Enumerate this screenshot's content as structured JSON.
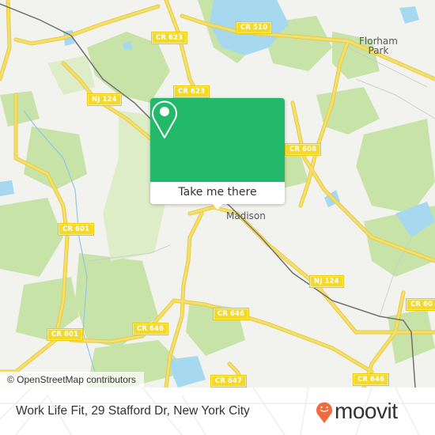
{
  "map": {
    "attribution": "© OpenStreetMap contributors",
    "colors": {
      "land": "#f2f2ee",
      "forest": "#c8e3a8",
      "park": "#dcedc8",
      "water": "#a6d8ef",
      "road": "#f5df6b",
      "road_casing": "#e8cb45",
      "rail": "#707070"
    },
    "places": [
      {
        "name": "Florham\nPark",
        "id": "florham-park"
      },
      {
        "name": "Madison",
        "id": "madison"
      }
    ],
    "road_shields": [
      {
        "label": "CR 623",
        "id": "cr623-top"
      },
      {
        "label": "CR 510",
        "id": "cr510"
      },
      {
        "label": "CR 623",
        "id": "cr623-mid"
      },
      {
        "label": "NJ 124",
        "id": "nj124-top"
      },
      {
        "label": "CR 608",
        "id": "cr608"
      },
      {
        "label": "CR 601",
        "id": "cr601-top"
      },
      {
        "label": "NJ 124",
        "id": "nj124-mid"
      },
      {
        "label": "CR 60",
        "id": "cr60-right"
      },
      {
        "label": "CR 601",
        "id": "cr601-bottom"
      },
      {
        "label": "CR 646",
        "id": "cr646-left"
      },
      {
        "label": "CR 646",
        "id": "cr646-mid"
      },
      {
        "label": "CR 647",
        "id": "cr647"
      },
      {
        "label": "CR 646",
        "id": "cr646-right"
      }
    ]
  },
  "popup": {
    "icon": "map-pin-icon",
    "action_label": "Take me there",
    "accent": "#22b96b"
  },
  "footer": {
    "title": "Work Life Fit, 29 Stafford Dr, New York City",
    "brand": "moovit",
    "brand_color": "#f26a3d"
  }
}
